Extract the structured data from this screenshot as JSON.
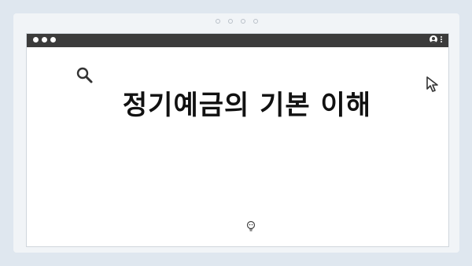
{
  "page": {
    "title": "정기예금의 기본 이해"
  },
  "icons": {
    "search": "search-icon",
    "cursor": "cursor-arrow-icon",
    "bulb": "lightbulb-icon",
    "profile": "profile-icon",
    "menu": "kebab-menu-icon"
  },
  "colors": {
    "background": "#dfe7ef",
    "frame": "#f1f4f7",
    "titlebar": "#3b3b3b",
    "window": "#ffffff",
    "text": "#111111"
  }
}
